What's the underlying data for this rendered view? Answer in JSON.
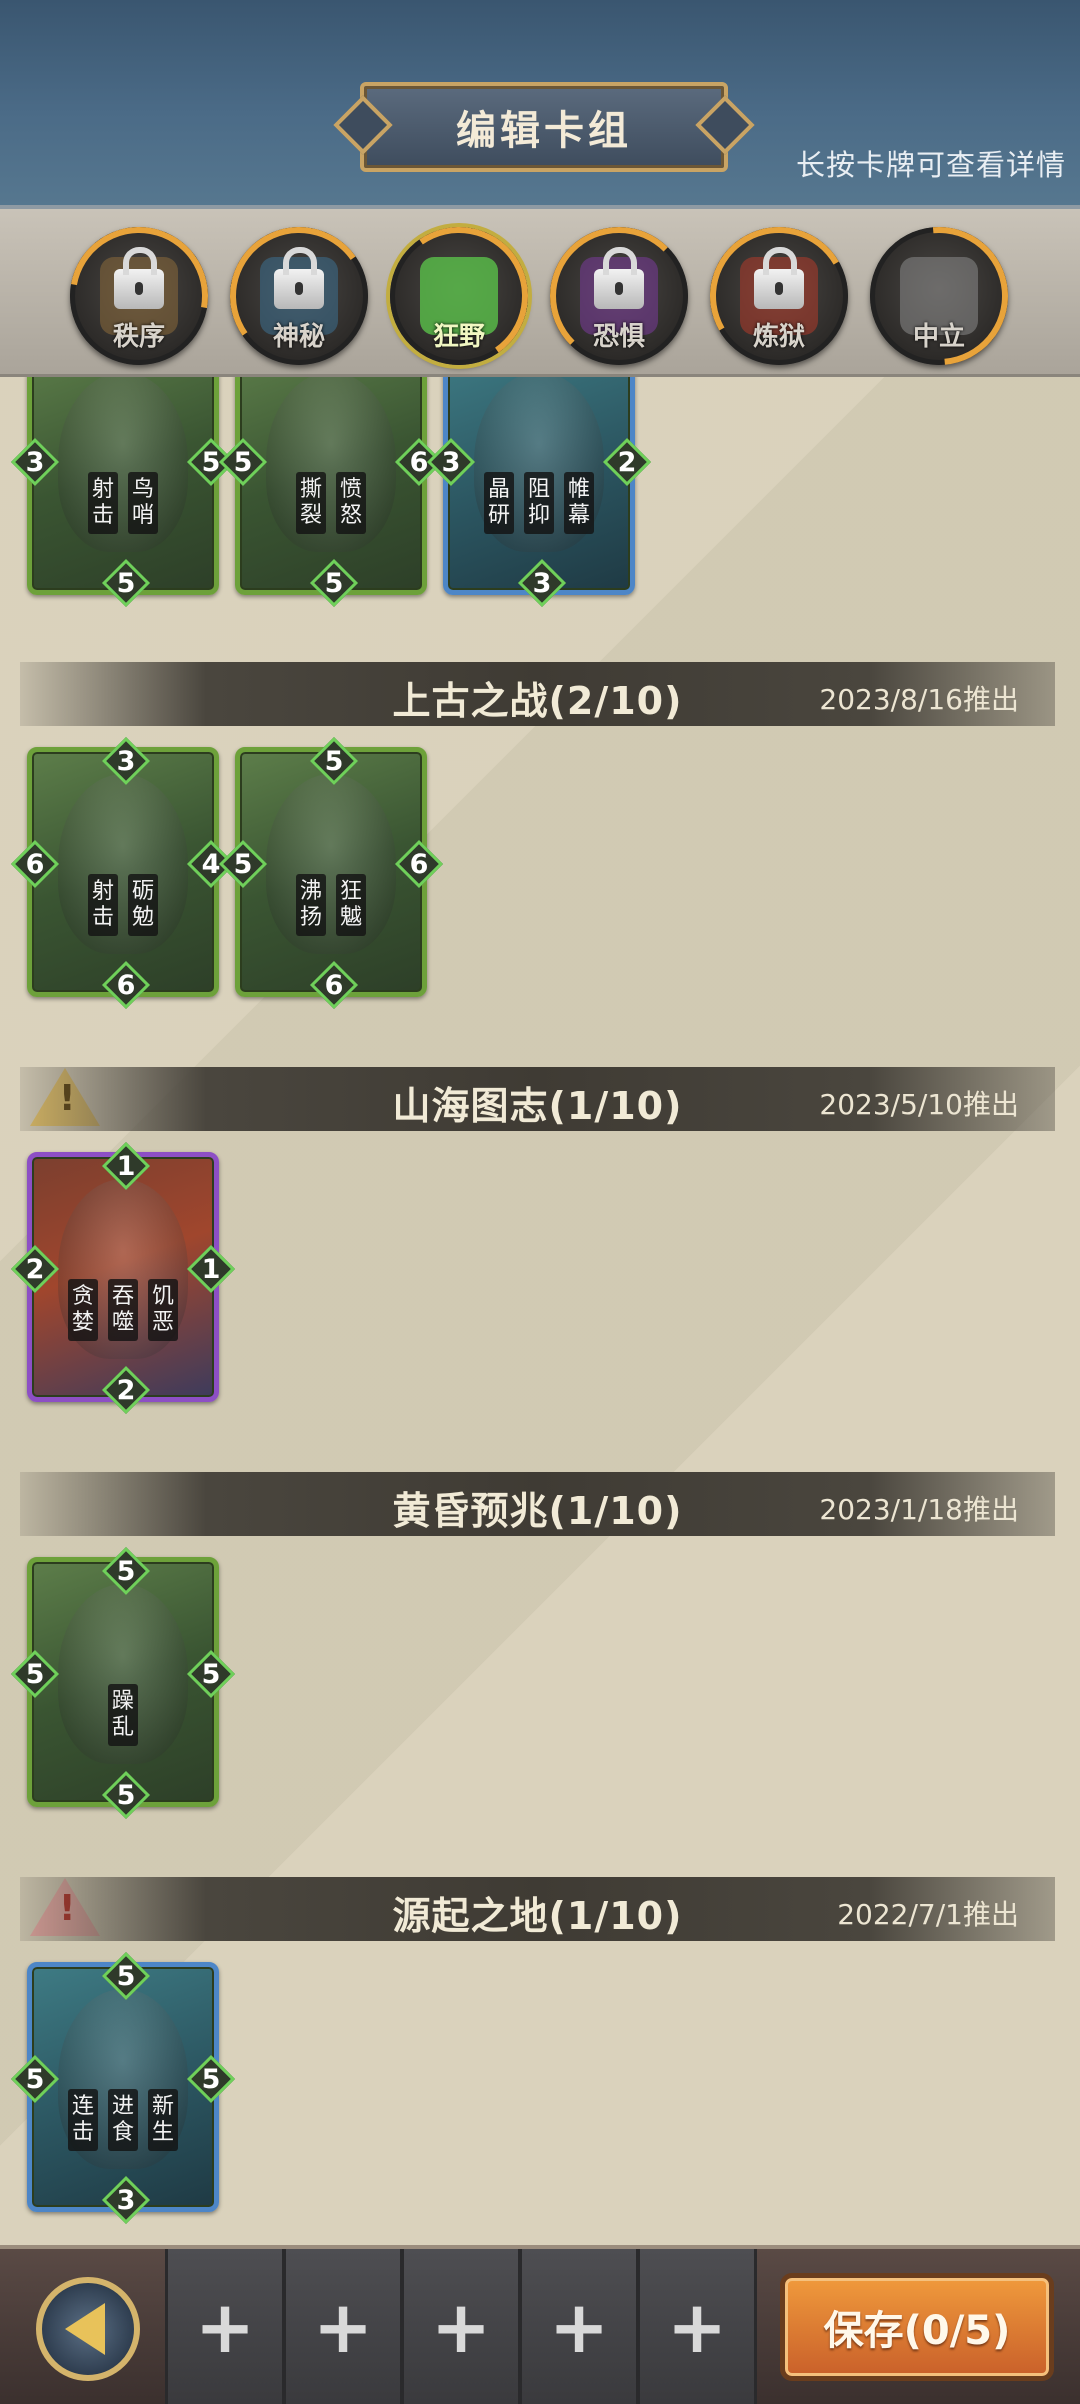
{
  "header": {
    "title": "编辑卡组",
    "hint": "长按卡牌可查看详情"
  },
  "factions": [
    {
      "label": "秩序",
      "icon": "order-emblem-icon",
      "locked": true,
      "color": "#8a6a3a"
    },
    {
      "label": "神秘",
      "icon": "mystic-emblem-icon",
      "locked": true,
      "color": "#3d6f8f"
    },
    {
      "label": "狂野",
      "icon": "wild-emblem-icon",
      "locked": false,
      "active": true,
      "color": "#5ac04a"
    },
    {
      "label": "恐惧",
      "icon": "fear-emblem-icon",
      "locked": true,
      "color": "#7a3a9a"
    },
    {
      "label": "炼狱",
      "icon": "inferno-emblem-icon",
      "locked": true,
      "color": "#b03a2a"
    },
    {
      "label": "中立",
      "icon": "neutral-emblem-icon",
      "locked": false,
      "color": "#8a8a8a"
    }
  ],
  "top_cards": [
    {
      "top": "",
      "left": "3",
      "right": "5",
      "bottom": "5",
      "skills": [
        "射击",
        "鸟哨"
      ],
      "frame": "green"
    },
    {
      "top": "",
      "left": "5",
      "right": "6",
      "bottom": "5",
      "skills": [
        "撕裂",
        "愤怒"
      ],
      "frame": "green"
    },
    {
      "top": "",
      "left": "3",
      "right": "2",
      "bottom": "3",
      "skills": [
        "晶研",
        "阻抑",
        "帷幕"
      ],
      "frame": "blue"
    }
  ],
  "sections": [
    {
      "title": "上古之战(2/10)",
      "date": "2023/8/16推出",
      "warning": "",
      "cards": [
        {
          "top": "3",
          "left": "6",
          "right": "4",
          "bottom": "6",
          "skills": [
            "射击",
            "砺勉"
          ],
          "frame": "green"
        },
        {
          "top": "5",
          "left": "5",
          "right": "6",
          "bottom": "6",
          "skills": [
            "沸扬",
            "狂魆"
          ],
          "frame": "green"
        }
      ]
    },
    {
      "title": "山海图志(1/10)",
      "date": "2023/5/10推出",
      "warning": "yellow",
      "cards": [
        {
          "top": "1",
          "left": "2",
          "right": "1",
          "bottom": "2",
          "skills": [
            "贪婪",
            "吞噬",
            "饥恶"
          ],
          "frame": "purple"
        }
      ]
    },
    {
      "title": "黄昏预兆(1/10)",
      "date": "2023/1/18推出",
      "warning": "",
      "cards": [
        {
          "top": "5",
          "left": "5",
          "right": "5",
          "bottom": "5",
          "skills": [
            "躁乱"
          ],
          "frame": "green"
        }
      ]
    },
    {
      "title": "源起之地(1/10)",
      "date": "2022/7/1推出",
      "warning": "red",
      "cards": [
        {
          "top": "5",
          "left": "5",
          "right": "5",
          "bottom": "3",
          "skills": [
            "连击",
            "进食",
            "新生"
          ],
          "frame": "blue"
        }
      ]
    }
  ],
  "warning_glyph": "!",
  "bottom": {
    "slots": [
      "+",
      "+",
      "+",
      "+",
      "+"
    ],
    "save_label": "保存(0/5)"
  }
}
